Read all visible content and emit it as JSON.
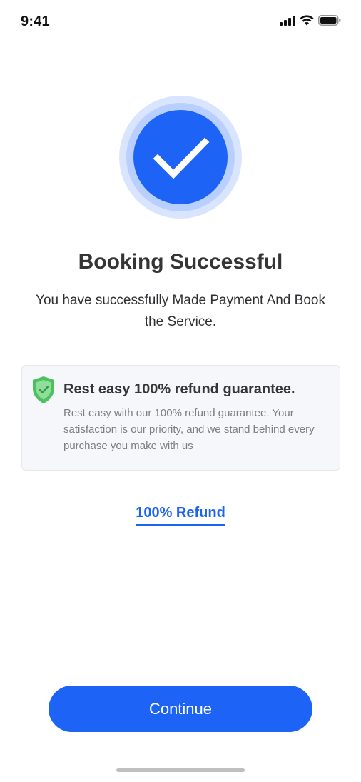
{
  "status_bar": {
    "time": "9:41",
    "icons": [
      "signal-icon",
      "wifi-icon",
      "battery-icon"
    ]
  },
  "success": {
    "icon": "check-icon",
    "title": "Booking Successful",
    "subtitle": "You have successfully Made Payment And Book the Service."
  },
  "guarantee": {
    "icon": "shield-check-icon",
    "title": "Rest easy 100% refund guarantee.",
    "text": "Rest easy with our 100% refund guarantee. Your satisfaction is our priority, and we stand behind every purchase you make with us"
  },
  "refund_link": "100% Refund",
  "continue_label": "Continue",
  "colors": {
    "accent": "#1d63f5",
    "shield_green": "#4cc25f",
    "card_bg": "#f5f7fb"
  }
}
